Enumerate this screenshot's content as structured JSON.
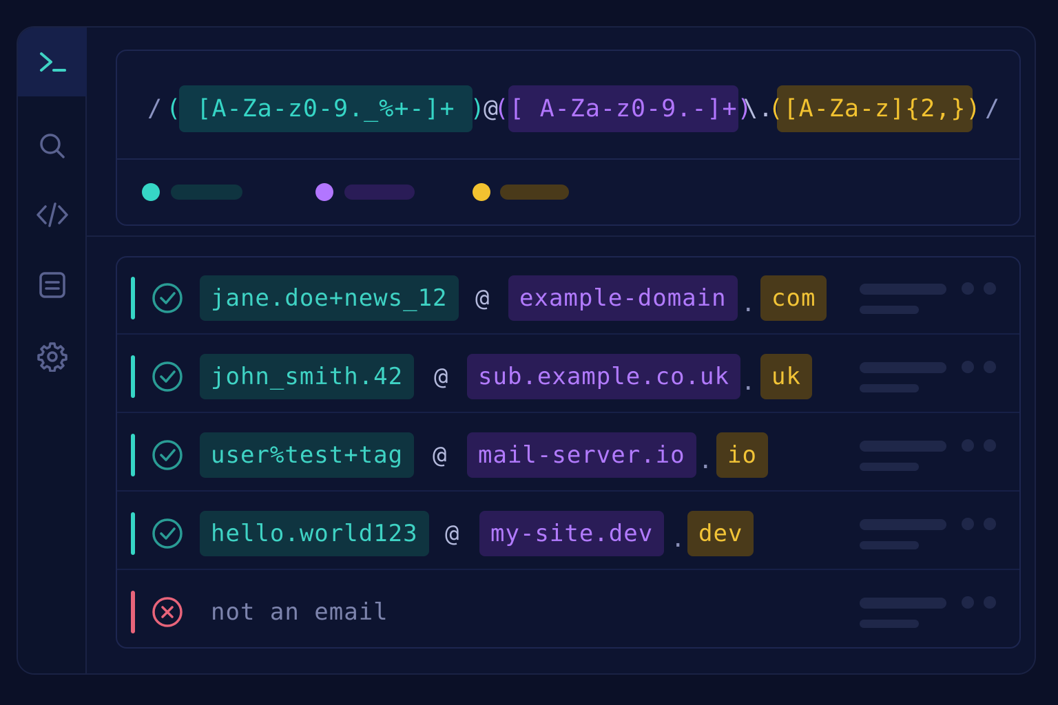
{
  "sidebar": {
    "items": [
      {
        "name": "terminal",
        "icon": "terminal-icon",
        "active": true
      },
      {
        "name": "search",
        "icon": "search-icon",
        "active": false
      },
      {
        "name": "code",
        "icon": "code-icon",
        "active": false
      },
      {
        "name": "document",
        "icon": "document-icon",
        "active": false
      },
      {
        "name": "settings",
        "icon": "gear-icon",
        "active": false
      }
    ]
  },
  "pattern": {
    "open_delim": "/",
    "group1": "( [A-Za-z0-9._%+-]+ )",
    "at": "@",
    "group2": "([ A-Za-z0-9.-]+)",
    "escaped_dot": "\\.",
    "group3": "([A-Za-z]{2,})",
    "close_delim": "/"
  },
  "legend": {
    "colors": {
      "group1": "#36d6c6",
      "group2": "#b276ff",
      "group3": "#f2c230"
    }
  },
  "results": [
    {
      "status": "match",
      "user": "jane.doe+news_12",
      "at": "@",
      "domain": "example-domain",
      "dot": ".",
      "tld": "com"
    },
    {
      "status": "match",
      "user": "john_smith.42",
      "at": "@",
      "domain": "sub.example.co.uk",
      "dot": ".",
      "tld": "uk"
    },
    {
      "status": "match",
      "user": "user%test+tag",
      "at": "@",
      "domain": "mail-server.io",
      "dot": ".",
      "tld": "io"
    },
    {
      "status": "match",
      "user": "hello.world123",
      "at": "@",
      "domain": "my-site.dev",
      "dot": ".",
      "tld": "dev"
    },
    {
      "status": "no-match",
      "text": "not an email"
    }
  ],
  "colors": {
    "match": "#36d6c6",
    "no_match": "#e8647a",
    "background": "#0b1027"
  }
}
